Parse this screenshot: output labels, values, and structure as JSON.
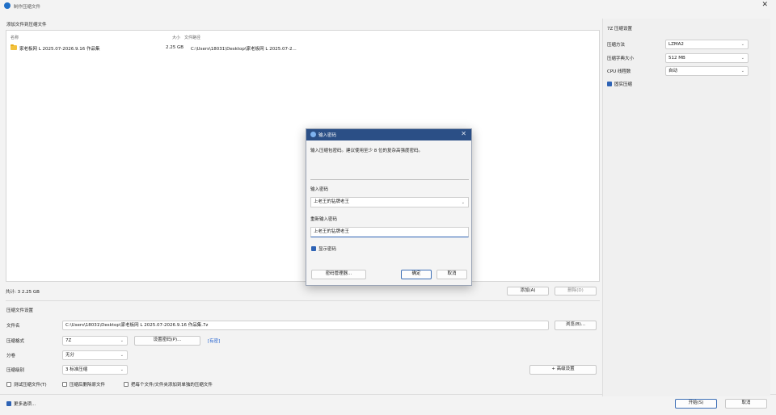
{
  "window": {
    "title": "制作压缩文件",
    "close_glyph": "✕"
  },
  "files": {
    "section_title": "添加文件到压缩文件",
    "columns": {
      "name": "名称",
      "size": "大小",
      "path": "文件路径"
    },
    "rows": [
      {
        "name": "家老板网 L 2025.07-2026.9.16 作品集",
        "size": "2.25 GB",
        "path": "C:\\Users\\18031\\Desktop\\家老板网 L 2025.07-2..."
      }
    ],
    "summary": "共计: 3 2.25 GB",
    "add_button": "添加(A)",
    "remove_button": "删除(D)"
  },
  "archive": {
    "section_title": "压缩文件设置",
    "filename_label": "文件名",
    "filename_value": "C:\\Users\\18031\\Desktop\\家老板网 L 2025.07-2026.9.16 作品集.7z",
    "browse_button": "浏览(B)...",
    "format_label": "压缩格式",
    "format_value": "7Z",
    "set_password_button": "设置密码(P)...",
    "password_link": "[有密]",
    "split_label": "分卷",
    "split_value": "无分",
    "level_label": "压缩级别",
    "level_value": "3 标准压缩",
    "advanced_button": "+ 高级设置",
    "options": [
      {
        "label": "测试压缩文件(T)",
        "checked": false
      },
      {
        "label": "压缩后删除原文件",
        "checked": false
      },
      {
        "label": "把每个文件/文件夹添加到单独的压缩文件",
        "checked": false
      }
    ]
  },
  "footer": {
    "more_options": "更多选项...",
    "start_button": "开始(S)",
    "cancel_button": "取消"
  },
  "zip_settings": {
    "title": "7Z 压缩设置",
    "method_label": "压缩方法",
    "method_value": "LZMA2",
    "dict_label": "压缩字典大小",
    "dict_value": "512 MB",
    "cpu_label": "CPU 线程数",
    "cpu_value": "自动",
    "solid_label": "固实压缩",
    "solid_checked": true
  },
  "password_dialog": {
    "title": "输入密码",
    "close_glyph": "✕",
    "hint": "输入压缩包密码。建议使用至少 8 位的复杂高强度密码。",
    "password_label": "输入密码",
    "password_value": "上老王的钻牌老王",
    "confirm_label": "重新输入密码",
    "confirm_value": "上老王的钻牌老王",
    "show_password_label": "显示密码",
    "show_password_checked": true,
    "manager_button": "密码管理器...",
    "ok_button": "确定",
    "cancel_button": "取消"
  }
}
